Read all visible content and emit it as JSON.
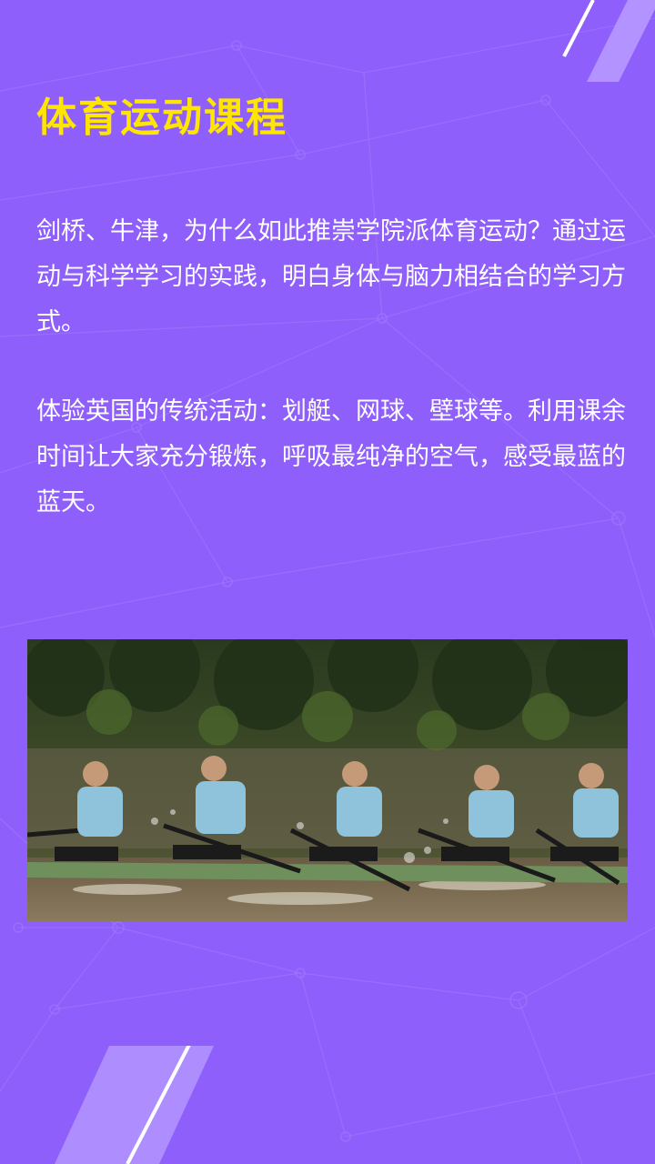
{
  "content": {
    "title": "体育运动课程",
    "paragraph_1": "剑桥、牛津，为什么如此推崇学院派体育运动？通过运动与科学学习的实践，明白身体与脑力相结合的学习方式。",
    "paragraph_2": "体验英国的传统活动：划艇、网球、壁球等。利用课余时间让大家充分锻炼，呼吸最纯净的空气，感受最蓝的蓝天。"
  },
  "colors": {
    "background": "#8f5ffb",
    "title": "#ffe600",
    "text": "#ffffff"
  },
  "photo": {
    "subject": "rowing-crew-photo"
  }
}
